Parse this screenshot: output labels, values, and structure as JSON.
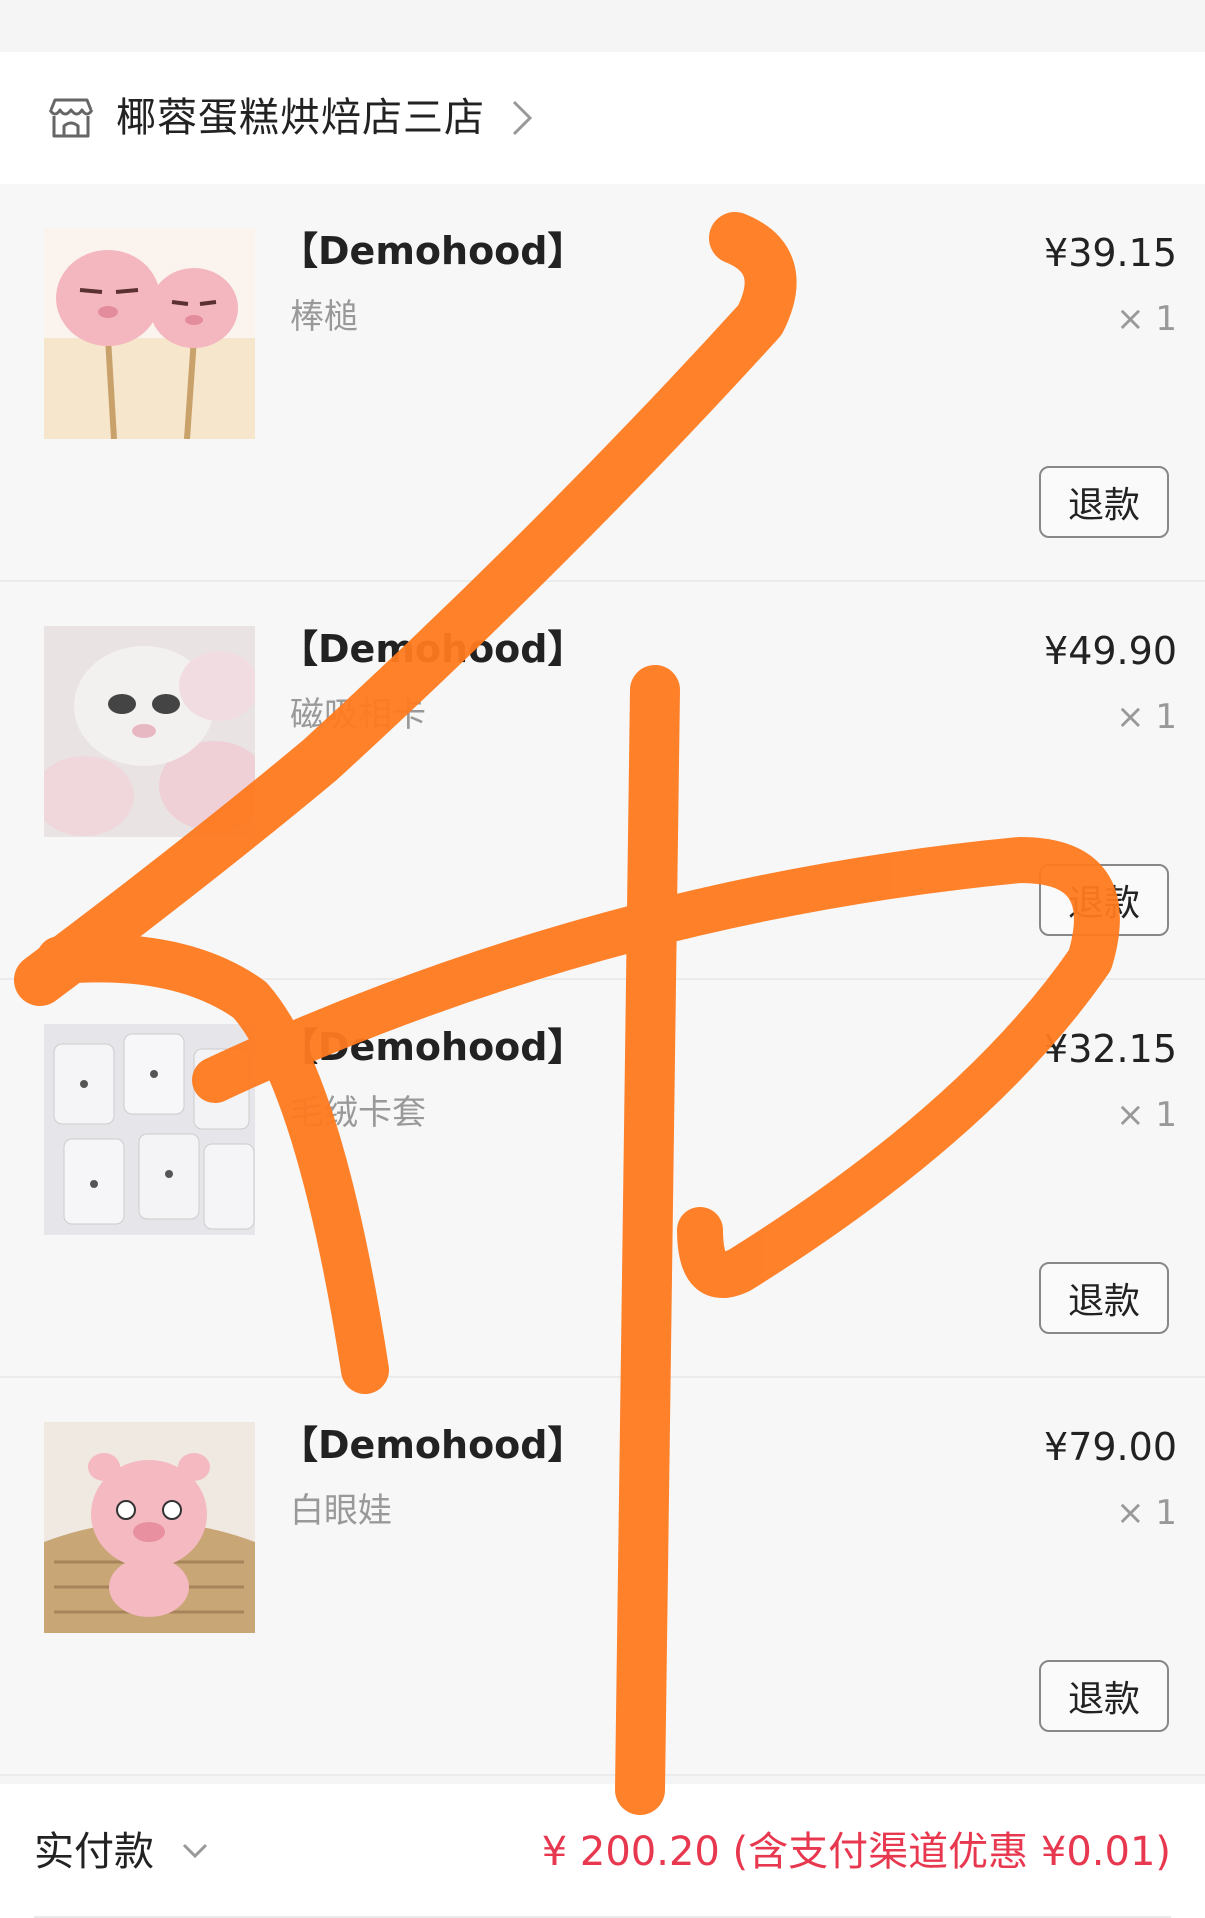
{
  "store": {
    "name": "椰蓉蛋糕烘焙店三店",
    "icon": "store-icon",
    "chevron_icon": "chevron-right-icon"
  },
  "items": [
    {
      "title": "【Demohood】",
      "subtitle": "棒槌",
      "price": "¥39.15",
      "qty": "× 1",
      "refund_label": "退款",
      "thumb": "pink-pig-head-lollipops"
    },
    {
      "title": "【Demohood】",
      "subtitle": "磁吸相卡",
      "price": "¥49.90",
      "qty": "× 1",
      "refund_label": "退款",
      "thumb": "pink-pig-plush-pile"
    },
    {
      "title": "【Demohood】",
      "subtitle": "毛绒卡套",
      "price": "¥32.15",
      "qty": "× 1",
      "refund_label": "退款",
      "thumb": "white-card-holders"
    },
    {
      "title": "【Demohood】",
      "subtitle": "白眼娃",
      "price": "¥79.00",
      "qty": "× 1",
      "refund_label": "退款",
      "thumb": "pink-pig-plush-doll"
    }
  ],
  "footer": {
    "label": "实付款",
    "chevron_icon": "chevron-down-icon",
    "amount": "¥ 200.20 (含支付渠道优惠 ¥0.01)"
  },
  "colors": {
    "accent_red": "#e8384f",
    "scribble_orange": "#ff7a1f"
  },
  "overlay": "orange-handwritten-scribble"
}
